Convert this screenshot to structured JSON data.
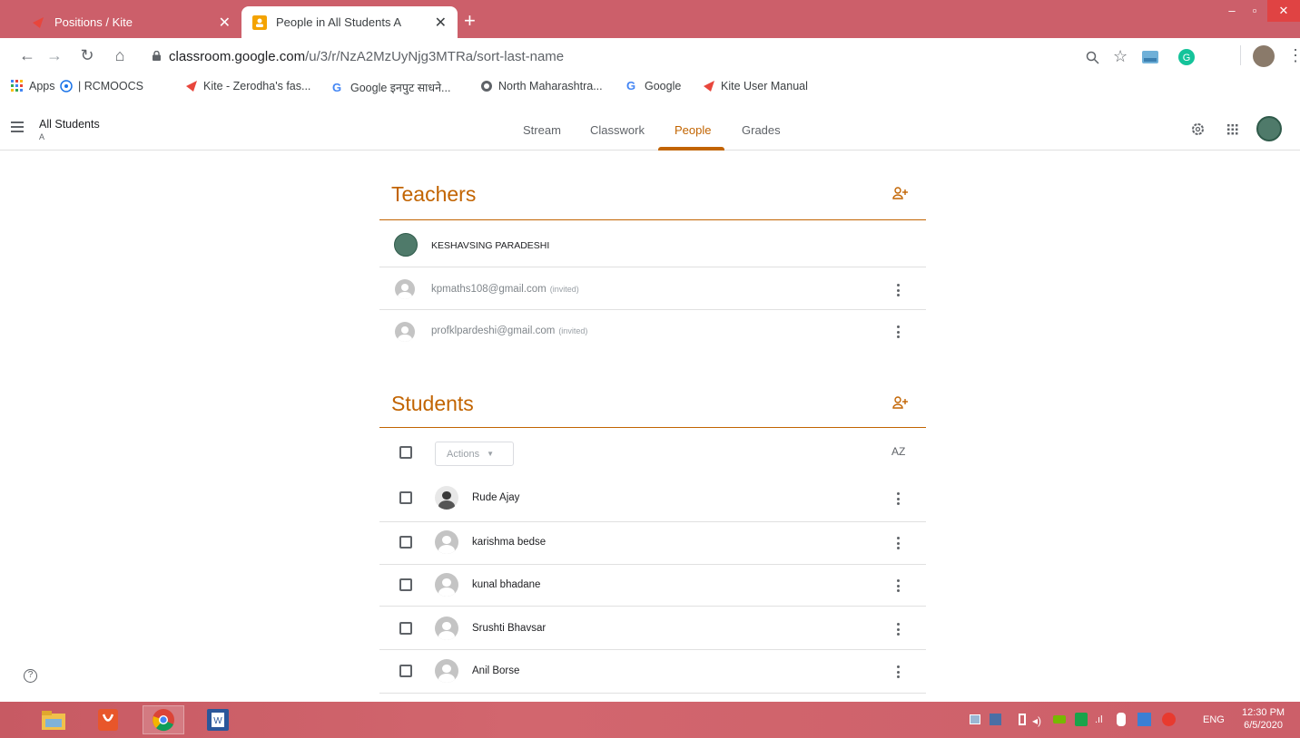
{
  "browser": {
    "tabs": [
      {
        "title": "Positions / Kite",
        "active": false
      },
      {
        "title": "People in All Students A",
        "active": true
      }
    ],
    "new_tab": "+",
    "url_host": "classroom.google.com",
    "url_path": "/u/3/r/NzA2MzUyNjg3MTRa/sort-last-name",
    "bookmarks": [
      {
        "label": "Apps"
      },
      {
        "label": "| RCMOOCS"
      },
      {
        "label": "Kite - Zerodha's fas..."
      },
      {
        "label": "Google इनपुट साधने..."
      },
      {
        "label": "North Maharashtra..."
      },
      {
        "label": "Google"
      },
      {
        "label": "Kite User Manual"
      }
    ]
  },
  "header": {
    "class_name": "All Students",
    "section": "A",
    "tabs": [
      "Stream",
      "Classwork",
      "People",
      "Grades"
    ],
    "active_tab": "People"
  },
  "teachers": {
    "title": "Teachers",
    "people": [
      {
        "name": "KESHAVSING PARADESHI"
      },
      {
        "email": "kpmaths108@gmail.com",
        "status": "(invited)"
      },
      {
        "email": "profklpardeshi@gmail.com",
        "status": "(invited)"
      }
    ]
  },
  "students": {
    "title": "Students",
    "actions_label": "Actions",
    "sort_label": "AZ",
    "people": [
      {
        "name": "Rude Ajay"
      },
      {
        "name": "karishma bedse"
      },
      {
        "name": "kunal bhadane"
      },
      {
        "name": "Srushti Bhavsar"
      },
      {
        "name": "Anil Borse"
      }
    ]
  },
  "help": "?",
  "taskbar": {
    "lang": "ENG",
    "time": "12:30 PM",
    "date": "6/5/2020"
  },
  "colors": {
    "accent": "#c26401",
    "chrome": "#cc5f6a"
  }
}
